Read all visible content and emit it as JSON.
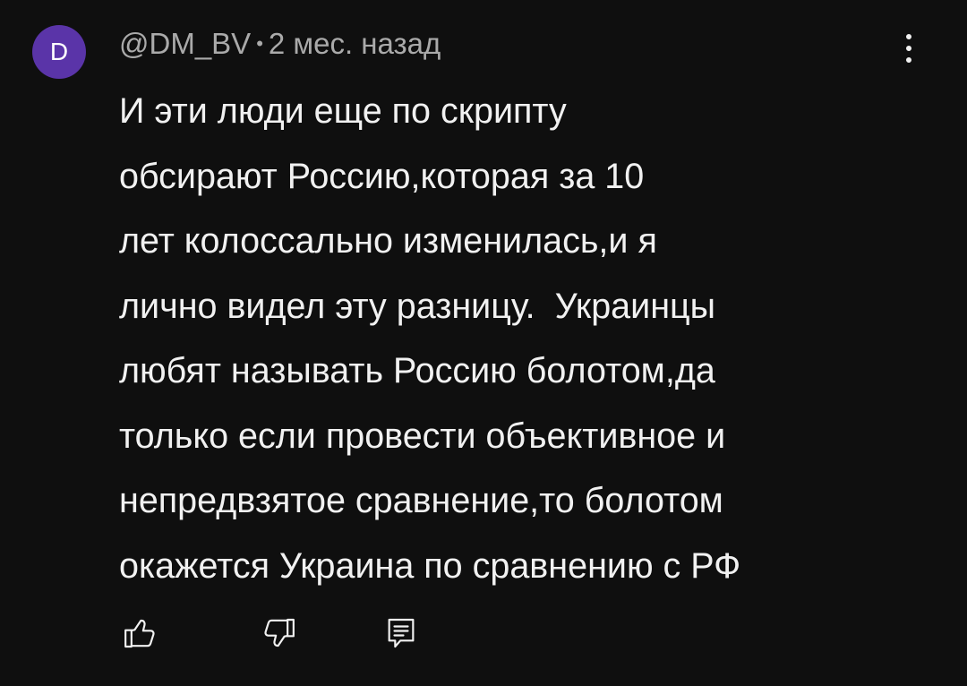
{
  "comment": {
    "avatar_letter": "D",
    "avatar_color": "#5a34a8",
    "author": "@DM_BV",
    "separator": "•",
    "timestamp": "2 мес. назад",
    "menu_icon": "more-vert-icon",
    "text_lines": [
      "И эти люди еще по скрипту",
      "обсирают Россию,которая за 10",
      "лет колоссально изменилась,и я",
      "лично видел эту разницу.  Украинцы",
      "любят называть Россию болотом,да",
      "только если провести объективное и",
      "непредвзятое сравнение,то болотом",
      "окажется Украина по сравнению с РФ"
    ],
    "actions": {
      "like_icon": "thumb-up-icon",
      "dislike_icon": "thumb-down-icon",
      "reply_icon": "reply-comment-icon"
    }
  },
  "colors": {
    "background": "#0f0f0f",
    "text_primary": "#f1f1f1",
    "text_secondary": "#aaaaaa"
  }
}
